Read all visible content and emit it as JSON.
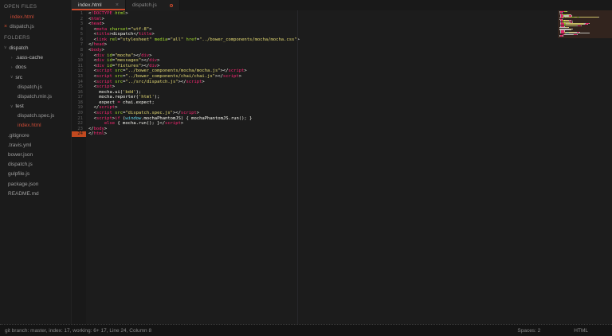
{
  "colors": {
    "accent": "#cc4b2d",
    "selected_file": "#cc4b37",
    "tag": "#f92672",
    "attribute": "#a6e22e",
    "string": "#e6db74",
    "support": "#66d9ef",
    "plain": "#f8f8f2"
  },
  "sidebar": {
    "open_files_header": "OPEN FILES",
    "open_files": [
      {
        "name": "index.html",
        "selected": true,
        "modified": false
      },
      {
        "name": "dispatch.js",
        "selected": false,
        "modified": true
      }
    ],
    "folders_header": "FOLDERS",
    "tree": [
      {
        "label": "dispatch",
        "type": "folder",
        "expanded": true,
        "indent": 0,
        "selected": false
      },
      {
        "label": ".sass-cache",
        "type": "folder",
        "expanded": false,
        "indent": 1,
        "selected": false
      },
      {
        "label": "docs",
        "type": "folder",
        "expanded": false,
        "indent": 1,
        "selected": false
      },
      {
        "label": "src",
        "type": "folder",
        "expanded": true,
        "indent": 1,
        "selected": false
      },
      {
        "label": "dispatch.js",
        "type": "file",
        "indent": 2,
        "selected": false
      },
      {
        "label": "dispatch.min.js",
        "type": "file",
        "indent": 2,
        "selected": false
      },
      {
        "label": "test",
        "type": "folder",
        "expanded": true,
        "indent": 1,
        "selected": false
      },
      {
        "label": "dispatch.spec.js",
        "type": "file",
        "indent": 2,
        "selected": false
      },
      {
        "label": "index.html",
        "type": "file",
        "indent": 2,
        "selected": true
      },
      {
        "label": ".gitignore",
        "type": "file",
        "indent": 1,
        "selected": false
      },
      {
        "label": ".travis.yml",
        "type": "file",
        "indent": 1,
        "selected": false
      },
      {
        "label": "bower.json",
        "type": "file",
        "indent": 1,
        "selected": false
      },
      {
        "label": "dispatch.js",
        "type": "file",
        "indent": 1,
        "selected": false
      },
      {
        "label": "gulpfile.js",
        "type": "file",
        "indent": 1,
        "selected": false
      },
      {
        "label": "package.json",
        "type": "file",
        "indent": 1,
        "selected": false
      },
      {
        "label": "README.md",
        "type": "file",
        "indent": 1,
        "selected": false
      }
    ]
  },
  "tabs": [
    {
      "label": "index.html",
      "active": true,
      "modified": false,
      "close_glyph": "×"
    },
    {
      "label": "dispatch.js",
      "active": false,
      "modified": true
    }
  ],
  "editor": {
    "active_line": 24,
    "lines": [
      {
        "num": 1,
        "seg": [
          [
            "p",
            "<"
          ],
          [
            "t",
            "!DOCTYPE"
          ],
          [
            "g",
            " html"
          ],
          [
            "p",
            ">"
          ]
        ]
      },
      {
        "num": 2,
        "seg": [
          [
            "p",
            "<"
          ],
          [
            "t",
            "html"
          ],
          [
            "p",
            ">"
          ]
        ]
      },
      {
        "num": 3,
        "seg": [
          [
            "p",
            "<"
          ],
          [
            "t",
            "head"
          ],
          [
            "p",
            ">"
          ]
        ]
      },
      {
        "num": 4,
        "seg": [
          [
            "w",
            "  "
          ],
          [
            "p",
            "<"
          ],
          [
            "t",
            "meta"
          ],
          [
            "a",
            " charset"
          ],
          [
            "p",
            "="
          ],
          [
            "s",
            "\"utf-8\""
          ],
          [
            "p",
            ">"
          ]
        ]
      },
      {
        "num": 5,
        "seg": [
          [
            "w",
            "  "
          ],
          [
            "p",
            "<"
          ],
          [
            "t",
            "title"
          ],
          [
            "p",
            ">"
          ],
          [
            "w",
            "dispatch"
          ],
          [
            "p",
            "</"
          ],
          [
            "t",
            "title"
          ],
          [
            "p",
            ">"
          ]
        ]
      },
      {
        "num": 6,
        "seg": [
          [
            "w",
            "  "
          ],
          [
            "p",
            "<"
          ],
          [
            "t",
            "link"
          ],
          [
            "a",
            " rel"
          ],
          [
            "p",
            "="
          ],
          [
            "s",
            "\"stylesheet\""
          ],
          [
            "a",
            " media"
          ],
          [
            "p",
            "="
          ],
          [
            "s",
            "\"all\""
          ],
          [
            "a",
            " href"
          ],
          [
            "p",
            "="
          ],
          [
            "s",
            "\"../bower_components/mocha/mocha.css\""
          ],
          [
            "p",
            ">"
          ]
        ]
      },
      {
        "num": 7,
        "seg": [
          [
            "p",
            "</"
          ],
          [
            "t",
            "head"
          ],
          [
            "p",
            ">"
          ]
        ]
      },
      {
        "num": 8,
        "seg": [
          [
            "p",
            "<"
          ],
          [
            "t",
            "body"
          ],
          [
            "p",
            ">"
          ]
        ]
      },
      {
        "num": 9,
        "seg": [
          [
            "w",
            "  "
          ],
          [
            "p",
            "<"
          ],
          [
            "t",
            "div"
          ],
          [
            "a",
            " id"
          ],
          [
            "p",
            "="
          ],
          [
            "s",
            "\"mocha\""
          ],
          [
            "p",
            "></"
          ],
          [
            "t",
            "div"
          ],
          [
            "p",
            ">"
          ]
        ]
      },
      {
        "num": 10,
        "seg": [
          [
            "w",
            "  "
          ],
          [
            "p",
            "<"
          ],
          [
            "t",
            "div"
          ],
          [
            "a",
            " id"
          ],
          [
            "p",
            "="
          ],
          [
            "s",
            "\"messages\""
          ],
          [
            "p",
            "></"
          ],
          [
            "t",
            "div"
          ],
          [
            "p",
            ">"
          ]
        ]
      },
      {
        "num": 11,
        "seg": [
          [
            "w",
            "  "
          ],
          [
            "p",
            "<"
          ],
          [
            "t",
            "div"
          ],
          [
            "a",
            " id"
          ],
          [
            "p",
            "="
          ],
          [
            "s",
            "\"fixtures\""
          ],
          [
            "p",
            "></"
          ],
          [
            "t",
            "div"
          ],
          [
            "p",
            ">"
          ]
        ]
      },
      {
        "num": 12,
        "seg": [
          [
            "w",
            "  "
          ],
          [
            "p",
            "<"
          ],
          [
            "t",
            "script"
          ],
          [
            "a",
            " src"
          ],
          [
            "p",
            "="
          ],
          [
            "s",
            "\"../bower_components/mocha/mocha.js\""
          ],
          [
            "p",
            "></"
          ],
          [
            "t",
            "script"
          ],
          [
            "p",
            ">"
          ]
        ]
      },
      {
        "num": 13,
        "seg": [
          [
            "w",
            "  "
          ],
          [
            "p",
            "<"
          ],
          [
            "t",
            "script"
          ],
          [
            "a",
            " src"
          ],
          [
            "p",
            "="
          ],
          [
            "s",
            "\"../bower_components/chai/chai.js\""
          ],
          [
            "p",
            "></"
          ],
          [
            "t",
            "script"
          ],
          [
            "p",
            ">"
          ]
        ]
      },
      {
        "num": 14,
        "seg": [
          [
            "w",
            "  "
          ],
          [
            "p",
            "<"
          ],
          [
            "t",
            "script"
          ],
          [
            "a",
            " src"
          ],
          [
            "p",
            "="
          ],
          [
            "s",
            "\"../src/dispatch.js\""
          ],
          [
            "p",
            "></"
          ],
          [
            "t",
            "script"
          ],
          [
            "p",
            ">"
          ]
        ]
      },
      {
        "num": 15,
        "seg": [
          [
            "w",
            "  "
          ],
          [
            "p",
            "<"
          ],
          [
            "t",
            "script"
          ],
          [
            "p",
            ">"
          ]
        ]
      },
      {
        "num": 16,
        "seg": [
          [
            "w",
            "    mocha.ui("
          ],
          [
            "s",
            "'bdd'"
          ],
          [
            "w",
            ");"
          ]
        ]
      },
      {
        "num": 17,
        "seg": [
          [
            "w",
            "    mocha.reporter("
          ],
          [
            "s",
            "'html'"
          ],
          [
            "w",
            ");"
          ]
        ]
      },
      {
        "num": 18,
        "seg": [
          [
            "w",
            "    expect "
          ],
          [
            "k",
            "="
          ],
          [
            "w",
            " chai.expect;"
          ]
        ]
      },
      {
        "num": 19,
        "seg": [
          [
            "w",
            "  "
          ],
          [
            "p",
            "</"
          ],
          [
            "t",
            "script"
          ],
          [
            "p",
            ">"
          ]
        ]
      },
      {
        "num": 20,
        "seg": [
          [
            "w",
            "  "
          ],
          [
            "p",
            "<"
          ],
          [
            "t",
            "script"
          ],
          [
            "a",
            " src"
          ],
          [
            "p",
            "="
          ],
          [
            "s",
            "\"dispatch.spec.js\""
          ],
          [
            "p",
            "></"
          ],
          [
            "t",
            "script"
          ],
          [
            "p",
            ">"
          ]
        ]
      },
      {
        "num": 21,
        "seg": [
          [
            "w",
            "  "
          ],
          [
            "p",
            "<"
          ],
          [
            "t",
            "script"
          ],
          [
            "p",
            ">"
          ],
          [
            "k",
            "if"
          ],
          [
            "w",
            " ("
          ],
          [
            "b",
            "window"
          ],
          [
            "w",
            ".mochaPhantomJS) { mochaPhantomJS.run(); }"
          ]
        ]
      },
      {
        "num": 22,
        "seg": [
          [
            "w",
            "      "
          ],
          [
            "k",
            "else"
          ],
          [
            "w",
            " { mocha.run(); }"
          ],
          [
            "p",
            "</"
          ],
          [
            "t",
            "script"
          ],
          [
            "p",
            ">"
          ]
        ]
      },
      {
        "num": 23,
        "seg": [
          [
            "p",
            "</"
          ],
          [
            "t",
            "body"
          ],
          [
            "p",
            ">"
          ]
        ]
      },
      {
        "num": 24,
        "seg": [
          [
            "p",
            "</"
          ],
          [
            "t",
            "html"
          ],
          [
            "p",
            ">"
          ]
        ]
      }
    ]
  },
  "status_bar": {
    "left": "git branch: master, index: 17, working: 6+ 17, Line 24, Column 8",
    "spaces": "Spaces: 2",
    "syntax": "HTML"
  }
}
